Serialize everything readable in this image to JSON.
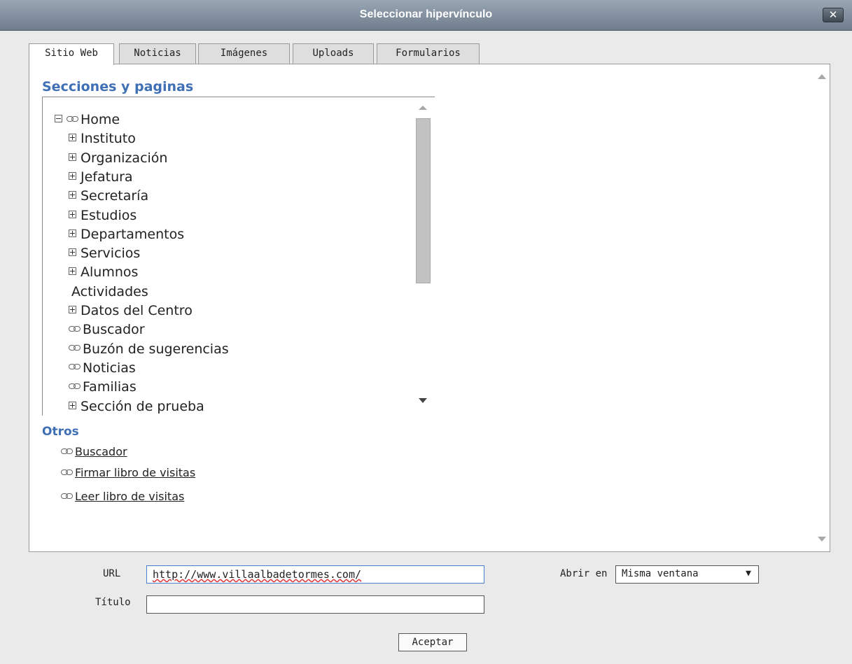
{
  "window": {
    "title": "Seleccionar hipervínculo",
    "close_label": "✕"
  },
  "tabs": [
    {
      "label": "Sitio Web",
      "active": true
    },
    {
      "label": "Noticias",
      "active": false
    },
    {
      "label": "Imágenes",
      "active": false
    },
    {
      "label": "Uploads",
      "active": false
    },
    {
      "label": "Formularios",
      "active": false
    }
  ],
  "sections": {
    "title": "Secciones y paginas",
    "tree": [
      {
        "label": "Home",
        "level": 0,
        "expander": "minus",
        "icon": "link-icon"
      },
      {
        "label": "Instituto",
        "level": 1,
        "expander": "plus",
        "icon": ""
      },
      {
        "label": "Organización",
        "level": 1,
        "expander": "plus",
        "icon": ""
      },
      {
        "label": "Jefatura",
        "level": 1,
        "expander": "plus",
        "icon": ""
      },
      {
        "label": "Secretaría",
        "level": 1,
        "expander": "plus",
        "icon": ""
      },
      {
        "label": "Estudios",
        "level": 1,
        "expander": "plus",
        "icon": ""
      },
      {
        "label": "Departamentos",
        "level": 1,
        "expander": "plus",
        "icon": ""
      },
      {
        "label": "Servicios",
        "level": 1,
        "expander": "plus",
        "icon": ""
      },
      {
        "label": "Alumnos",
        "level": 1,
        "expander": "plus",
        "icon": ""
      },
      {
        "label": "Actividades",
        "level": 1,
        "expander": "",
        "icon": ""
      },
      {
        "label": "Datos del Centro",
        "level": 1,
        "expander": "plus",
        "icon": ""
      },
      {
        "label": "Buscador",
        "level": 1,
        "expander": "",
        "icon": "link-icon"
      },
      {
        "label": "Buzón de sugerencias",
        "level": 1,
        "expander": "",
        "icon": "link-icon"
      },
      {
        "label": "Noticias",
        "level": 1,
        "expander": "",
        "icon": "link-icon"
      },
      {
        "label": "Familias",
        "level": 1,
        "expander": "",
        "icon": "link-icon"
      },
      {
        "label": "Sección de prueba",
        "level": 1,
        "expander": "plus",
        "icon": ""
      }
    ]
  },
  "others": {
    "title": "Otros",
    "links": [
      {
        "label": "Buscador",
        "icon": "link-icon"
      },
      {
        "label": "Firmar libro de visitas",
        "icon": "link-icon"
      },
      {
        "label": "Leer libro de visitas",
        "icon": "link-icon"
      }
    ]
  },
  "form": {
    "url_label": "URL",
    "url_value": "http://www.villaalbadetormes.com/",
    "title_label": "Título",
    "title_value": "",
    "open_in_label": "Abrir en",
    "open_in_value": "Misma ventana",
    "accept_label": "Aceptar"
  }
}
